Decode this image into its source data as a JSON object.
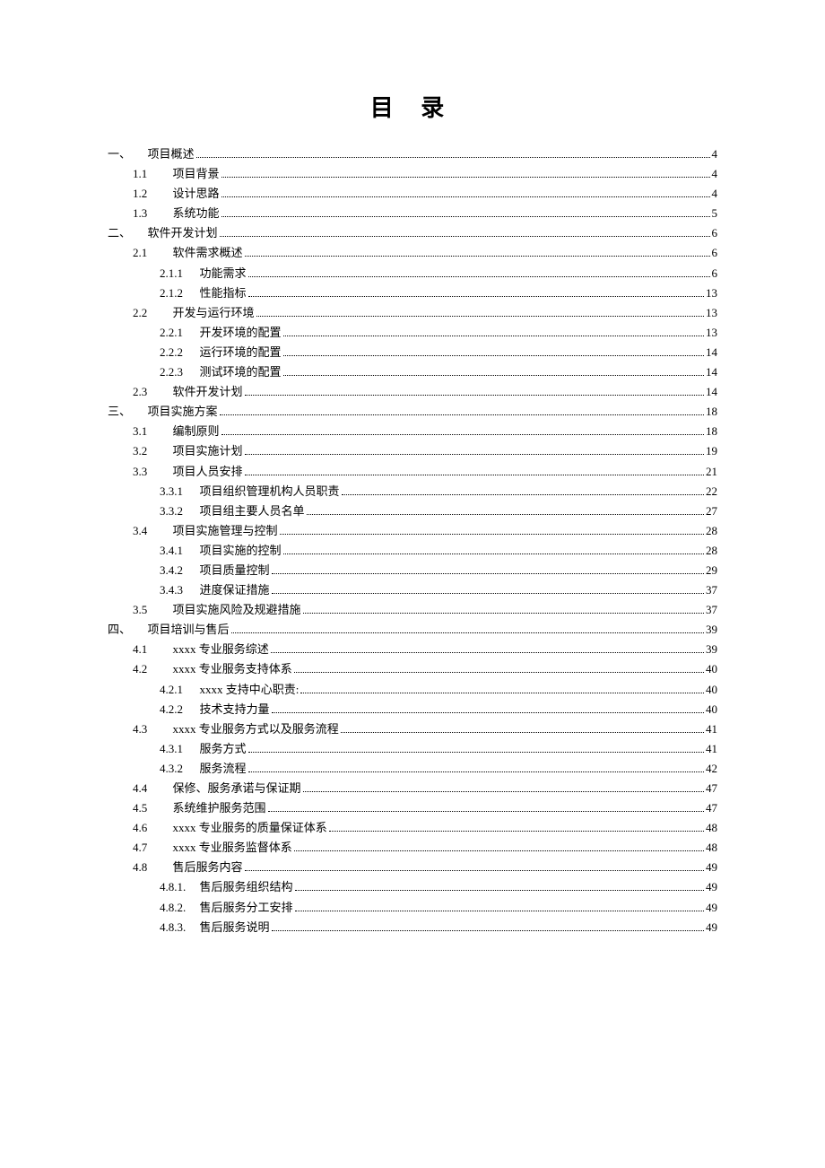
{
  "title": "目 录",
  "entries": [
    {
      "lvl": 1,
      "num": "一、",
      "label": "项目概述",
      "page": "4"
    },
    {
      "lvl": 2,
      "num": "1.1",
      "label": "项目背景",
      "page": "4"
    },
    {
      "lvl": 2,
      "num": "1.2",
      "label": "设计思路",
      "page": "4"
    },
    {
      "lvl": 2,
      "num": "1.3",
      "label": "系统功能",
      "page": "5"
    },
    {
      "lvl": 1,
      "num": "二、",
      "label": "软件开发计划",
      "page": "6"
    },
    {
      "lvl": 2,
      "num": "2.1",
      "label": "软件需求概述",
      "page": "6"
    },
    {
      "lvl": 3,
      "num": "2.1.1",
      "label": "功能需求",
      "page": "6"
    },
    {
      "lvl": 3,
      "num": "2.1.2",
      "label": "性能指标",
      "page": "13"
    },
    {
      "lvl": 2,
      "num": "2.2",
      "label": "开发与运行环境",
      "page": "13"
    },
    {
      "lvl": 3,
      "num": "2.2.1",
      "label": "开发环境的配置",
      "page": "13"
    },
    {
      "lvl": 3,
      "num": "2.2.2",
      "label": "运行环境的配置",
      "page": "14"
    },
    {
      "lvl": 3,
      "num": "2.2.3",
      "label": "测试环境的配置",
      "page": "14"
    },
    {
      "lvl": 2,
      "num": "2.3",
      "label": "软件开发计划",
      "page": "14"
    },
    {
      "lvl": 1,
      "num": "三、",
      "label": "项目实施方案",
      "page": "18"
    },
    {
      "lvl": 2,
      "num": "3.1",
      "label": "编制原则",
      "page": "18"
    },
    {
      "lvl": 2,
      "num": "3.2",
      "label": "项目实施计划",
      "page": "19"
    },
    {
      "lvl": 2,
      "num": "3.3",
      "label": "项目人员安排",
      "page": "21"
    },
    {
      "lvl": 3,
      "num": "3.3.1",
      "label": "项目组织管理机构人员职责",
      "page": "22"
    },
    {
      "lvl": 3,
      "num": "3.3.2",
      "label": "项目组主要人员名单",
      "page": "27"
    },
    {
      "lvl": 2,
      "num": "3.4",
      "label": "项目实施管理与控制",
      "page": "28"
    },
    {
      "lvl": 3,
      "num": "3.4.1",
      "label": "项目实施的控制",
      "page": "28"
    },
    {
      "lvl": 3,
      "num": "3.4.2",
      "label": "项目质量控制",
      "page": "29"
    },
    {
      "lvl": 3,
      "num": "3.4.3",
      "label": "进度保证措施",
      "page": "37"
    },
    {
      "lvl": 2,
      "num": "3.5",
      "label": "项目实施风险及规避措施",
      "page": "37"
    },
    {
      "lvl": 1,
      "num": "四、",
      "label": "项目培训与售后",
      "page": "39"
    },
    {
      "lvl": 2,
      "num": "4.1",
      "label": "xxxx 专业服务综述",
      "page": "39"
    },
    {
      "lvl": 2,
      "num": "4.2",
      "label": "xxxx 专业服务支持体系",
      "page": "40"
    },
    {
      "lvl": 3,
      "num": "4.2.1",
      "label": "xxxx 支持中心职责:",
      "page": "40"
    },
    {
      "lvl": 3,
      "num": "4.2.2",
      "label": "技术支持力量",
      "page": "40"
    },
    {
      "lvl": 2,
      "num": "4.3",
      "label": "xxxx 专业服务方式以及服务流程",
      "page": "41"
    },
    {
      "lvl": 3,
      "num": "4.3.1",
      "label": "服务方式",
      "page": "41"
    },
    {
      "lvl": 3,
      "num": "4.3.2",
      "label": "服务流程",
      "page": "42"
    },
    {
      "lvl": 2,
      "num": "4.4",
      "label": "保修、服务承诺与保证期",
      "page": "47"
    },
    {
      "lvl": 2,
      "num": "4.5",
      "label": "系统维护服务范围",
      "page": "47"
    },
    {
      "lvl": 2,
      "num": "4.6",
      "label": "xxxx 专业服务的质量保证体系",
      "page": "48"
    },
    {
      "lvl": 2,
      "num": "4.7",
      "label": "xxxx 专业服务监督体系",
      "page": "48"
    },
    {
      "lvl": 2,
      "num": "4.8",
      "label": "售后服务内容",
      "page": "49"
    },
    {
      "lvl": 3,
      "num": "4.8.1.",
      "label": "售后服务组织结构",
      "page": "49"
    },
    {
      "lvl": 3,
      "num": "4.8.2.",
      "label": "售后服务分工安排",
      "page": "49"
    },
    {
      "lvl": 3,
      "num": "4.8.3.",
      "label": "售后服务说明",
      "page": "49"
    }
  ]
}
